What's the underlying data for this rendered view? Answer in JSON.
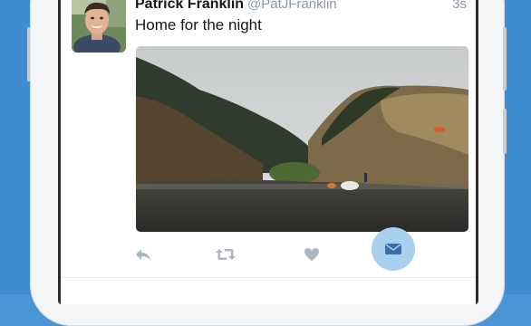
{
  "tweet": {
    "display_name": "Patrick Franklin",
    "handle": "@PatJFranklin",
    "timestamp": "3s",
    "text": "Home for the night"
  },
  "actions": {
    "reply_icon": "reply-icon",
    "retweet_icon": "retweet-icon",
    "like_icon": "heart-icon",
    "dm_icon": "envelope-icon"
  },
  "colors": {
    "background": "#4a95d6",
    "action_icon": "#aab8c2",
    "dm_highlight": "#a9d0ee",
    "dm_icon": "#3b6fa8"
  }
}
